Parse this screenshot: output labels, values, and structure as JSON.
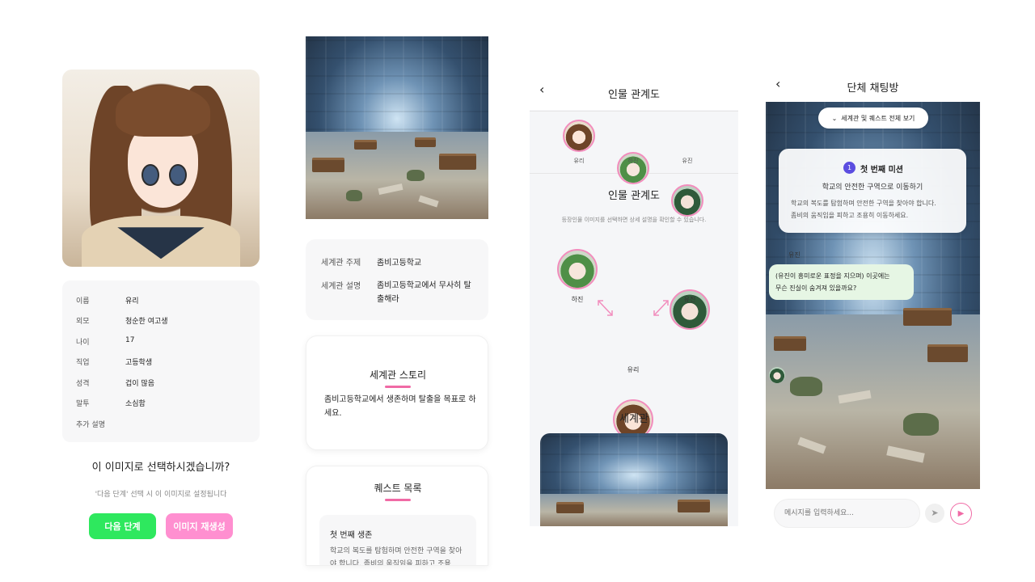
{
  "panel1": {
    "info": [
      {
        "key": "이름",
        "value": "유리"
      },
      {
        "key": "외모",
        "value": "청순한 여고생"
      },
      {
        "key": "나이",
        "value": "17"
      },
      {
        "key": "직업",
        "value": "고등학생"
      },
      {
        "key": "성격",
        "value": "겁이 많음"
      },
      {
        "key": "말투",
        "value": "소심함"
      },
      {
        "key": "추가 설명",
        "value": ""
      }
    ],
    "question": "이 이미지로 선택하시겠습니까?",
    "hint": "'다음 단계' 선택 시 이 이미지로 설정됩니다",
    "next_button": "다음 단계",
    "regen_button": "이미지 재생성",
    "colors": {
      "next": "#2ee85e",
      "regen": "#ff8fd0"
    }
  },
  "panel2": {
    "world": [
      {
        "key": "세계관 주제",
        "value": "좀비고등학교"
      },
      {
        "key": "세계관 설명",
        "value": "좀비고등학교에서 무사히 탈출해라"
      }
    ],
    "story_title": "세계관 스토리",
    "story_text": "좀비고등학교에서 생존하며 탈출을 목표로 하세요.",
    "quest_title": "퀘스트 목록",
    "quest_item_title": "첫 번째 생존",
    "quest_item_text": "학교의 복도를 탐험하며 안전한 구역을 찾아야 합니다. 좀비의 움직임을 피하고 조용"
  },
  "panel3": {
    "header_title": "인물 관계도",
    "top_avatars": [
      {
        "name": "유리",
        "icon": "yuri-avatar"
      },
      {
        "name": "하진",
        "icon": "hajin-avatar"
      },
      {
        "name": "유진",
        "icon": "yujin-avatar"
      }
    ],
    "section_title": "인물 관계도",
    "section_hint": "등장인물 이미지를 선택하면 상세 설명을 확인할 수 있습니다.",
    "graph": {
      "left": "하진",
      "right": "유진",
      "bottom": "유리"
    },
    "world_title": "세계관"
  },
  "panel4": {
    "header_title": "단체 채팅방",
    "view_all_button": "세계관 및 퀘스트 전체 보기",
    "mission_number": "1",
    "mission_title": "첫 번째 미션",
    "mission_subtitle": "학교의 안전한 구역으로 이동하기",
    "mission_text_1": "학교의 복도를 탐험하며 안전한 구역을 찾아야 합니다.",
    "mission_text_2": "좀비의 움직임을 피하고 조용히 이동하세요.",
    "chat_sender": "유진",
    "chat_line_1": "(유진이 흥미로운 표정을 지으며) 이곳에는",
    "chat_line_2": "무슨 진실이 숨겨져 있을까요?",
    "input_placeholder": "메시지를 입력하세요...",
    "colors": {
      "mission_badge": "#5b4de0",
      "play": "#f06aa5",
      "bubble": "#e6f6e4"
    }
  }
}
